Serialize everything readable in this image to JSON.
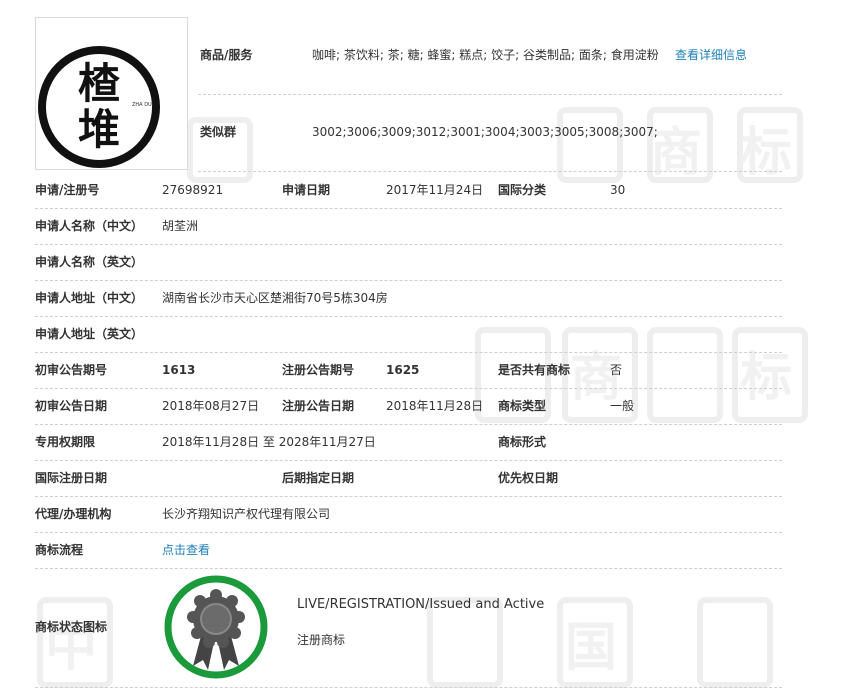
{
  "logo": {
    "char1": "楂",
    "char2": "堆",
    "pinyin": "ZHA DUI"
  },
  "top": {
    "goods_label": "商品/服务",
    "goods_value": "咖啡; 茶饮料; 茶; 糖; 蜂蜜; 糕点; 饺子; 谷类制品; 面条; 食用淀粉",
    "goods_link": "查看详细信息",
    "similar_label": "类似群",
    "similar_value": "3002;3006;3009;3012;3001;3004;3003;3005;3008;3007;"
  },
  "rows": {
    "reg_no_label": "申请/注册号",
    "reg_no": "27698921",
    "apply_date_label": "申请日期",
    "apply_date": "2017年11月24日",
    "intl_class_label": "国际分类",
    "intl_class": "30",
    "applicant_cn_label": "申请人名称（中文）",
    "applicant_cn": "胡荃洲",
    "applicant_en_label": "申请人名称（英文）",
    "address_cn_label": "申请人地址（中文）",
    "address_cn": "湖南省长沙市天心区楚湘街70号5栋304房",
    "address_en_label": "申请人地址（英文）",
    "prelim_no_label": "初审公告期号",
    "prelim_no": "1613",
    "reg_pub_no_label": "注册公告期号",
    "reg_pub_no": "1625",
    "shared_label": "是否共有商标",
    "shared": "否",
    "prelim_date_label": "初审公告日期",
    "prelim_date": "2018年08月27日",
    "reg_pub_date_label": "注册公告日期",
    "reg_pub_date": "2018年11月28日",
    "tm_type_label": "商标类型",
    "tm_type": "一般",
    "term_label": "专用权期限",
    "term": "2018年11月28日 至 2028年11月27日",
    "tm_form_label": "商标形式",
    "intl_reg_date_label": "国际注册日期",
    "later_date_label": "后期指定日期",
    "priority_date_label": "优先权日期",
    "agent_label": "代理/办理机构",
    "agent": "长沙齐翔知识产权代理有限公司",
    "process_label": "商标流程",
    "process_link": "点击查看",
    "status_icon_label": "商标状态图标",
    "status_en": "LIVE/REGISTRATION/Issued and Active",
    "status_cn": "注册商标"
  },
  "colors": {
    "link": "#1f7fb8",
    "status_ring": "#1a9a3a",
    "medal": "#555555",
    "divider": "#cfcfcf"
  },
  "icons": {
    "status": "registered-medal-icon",
    "watermark": "watermark-zhong-guo-shang-biao"
  }
}
